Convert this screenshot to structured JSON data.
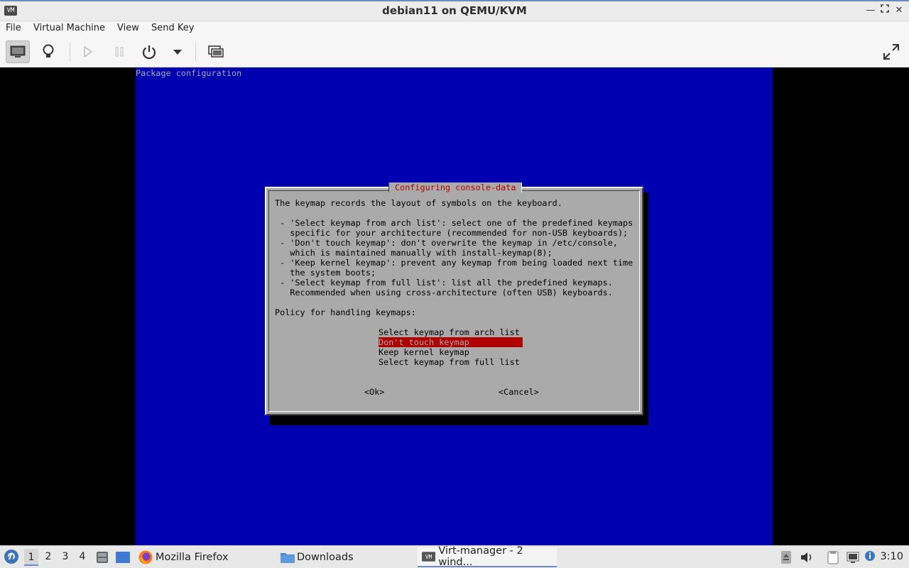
{
  "window": {
    "title": "debian11 on QEMU/KVM",
    "buttons": [
      "minimize",
      "maximize",
      "close"
    ]
  },
  "menu": {
    "items": [
      "File",
      "Virtual Machine",
      "View",
      "Send Key"
    ]
  },
  "toolbar": {
    "buttons": [
      "console",
      "details",
      "run",
      "pause",
      "shutdown",
      "shutdown-menu",
      "snapshots",
      "fullscreen"
    ]
  },
  "vm": {
    "header": "Package configuration",
    "dialog": {
      "title": "Configuring console-data",
      "lines": [
        "The keymap records the layout of symbols on the keyboard.",
        "",
        " - 'Select keymap from arch list': select one of the predefined keymaps",
        "   specific for your architecture (recommended for non-USB keyboards);",
        " - 'Don't touch keymap': don't overwrite the keymap in /etc/console,",
        "   which is maintained manually with install-keymap(8);",
        " - 'Keep kernel keymap': prevent any keymap from being loaded next time",
        "   the system boots;",
        " - 'Select keymap from full list': list all the predefined keymaps.",
        "   Recommended when using cross-architecture (often USB) keyboards.",
        "",
        "Policy for handling keymaps:"
      ],
      "options": [
        "Select keymap from arch list",
        "Don't touch keymap",
        "Keep kernel keymap",
        "Select keymap from full list"
      ],
      "selected_index": 1,
      "ok": "<Ok>",
      "cancel": "<Cancel>"
    }
  },
  "taskbar": {
    "workspaces": [
      "1",
      "2",
      "3",
      "4"
    ],
    "current_workspace": "1",
    "tasks": [
      {
        "label": "Mozilla Firefox",
        "icon": "firefox-icon"
      },
      {
        "label": "Downloads",
        "icon": "folder-icon"
      },
      {
        "label": "Virt-manager - 2 wind...",
        "icon": "virt-manager-icon"
      }
    ],
    "clock": "3:10"
  },
  "colors": {
    "vm_background": "#0000b0",
    "dialog_bg": "#aaaaaa",
    "highlight": "#b00000",
    "accent": "#6d8dc4"
  }
}
